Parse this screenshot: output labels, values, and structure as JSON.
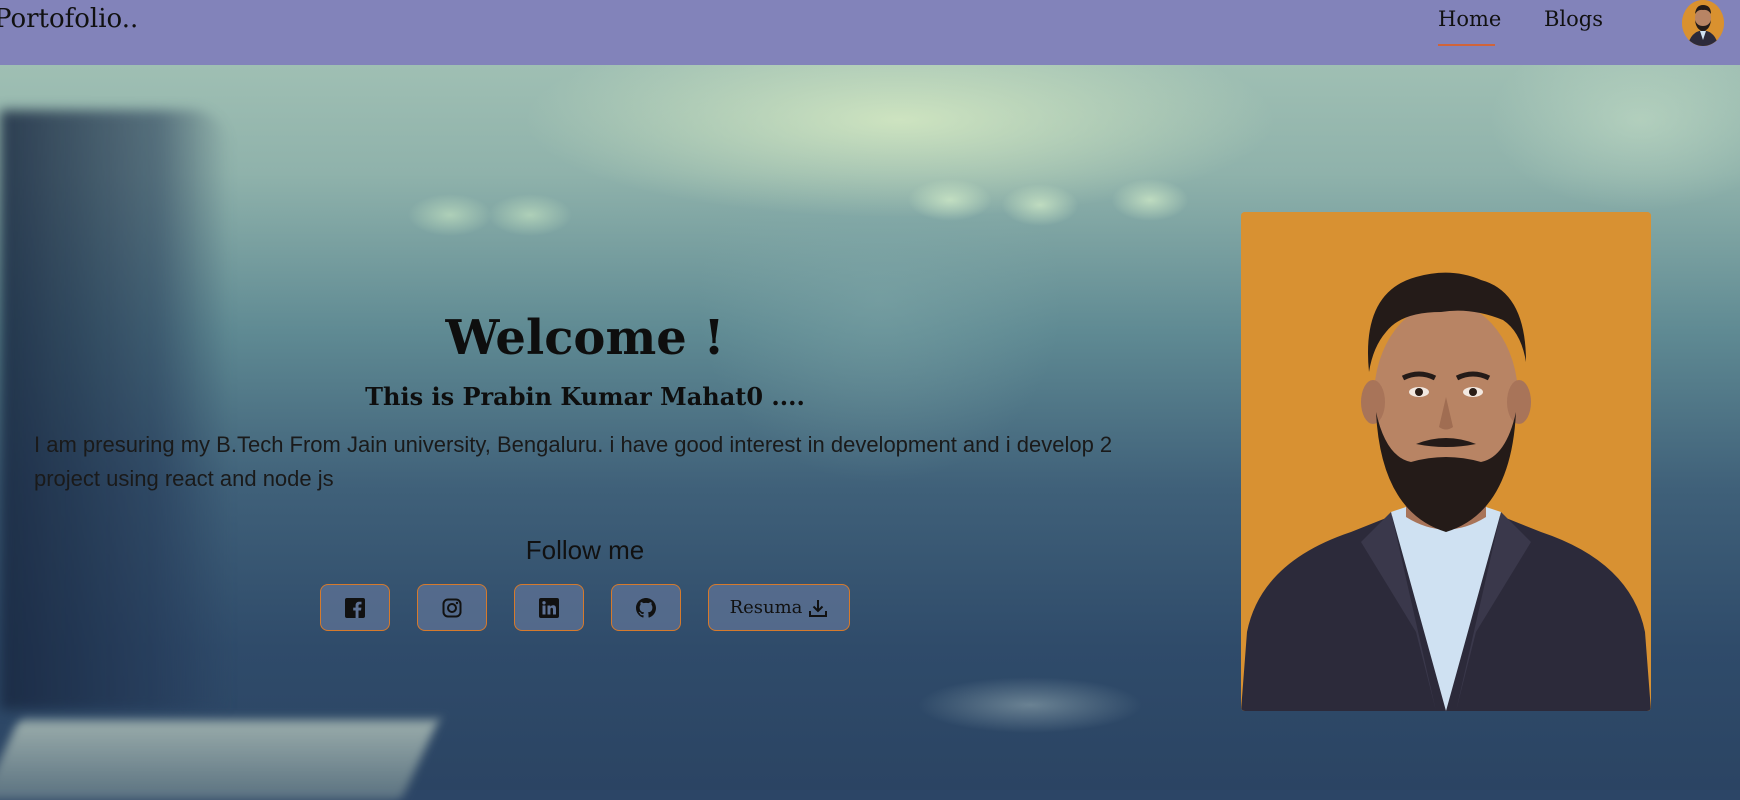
{
  "navbar": {
    "brand": "Portofolio..",
    "links": [
      {
        "label": "Home",
        "active": true
      },
      {
        "label": "Blogs",
        "active": false
      }
    ],
    "background_color": "#8283ba",
    "active_underline_color": "#d0643a"
  },
  "hero": {
    "heading": "Welcome !",
    "subheading": "This is Prabin Kumar Mahat0 ....",
    "description": "I am presuring my B.Tech From Jain university, Bengaluru. i have good interest in development and i develop 2 project using react and node js",
    "follow_label": "Follow me",
    "social_buttons": [
      {
        "icon": "facebook-icon"
      },
      {
        "icon": "instagram-icon"
      },
      {
        "icon": "linkedin-icon"
      },
      {
        "icon": "github-icon"
      }
    ],
    "resume_button": {
      "label": "Resuma",
      "icon": "download-icon"
    },
    "button_border_color": "#d67a2c"
  },
  "profile": {
    "photo_background_color": "#d89132",
    "jacket_color": "#2c2a3a"
  }
}
